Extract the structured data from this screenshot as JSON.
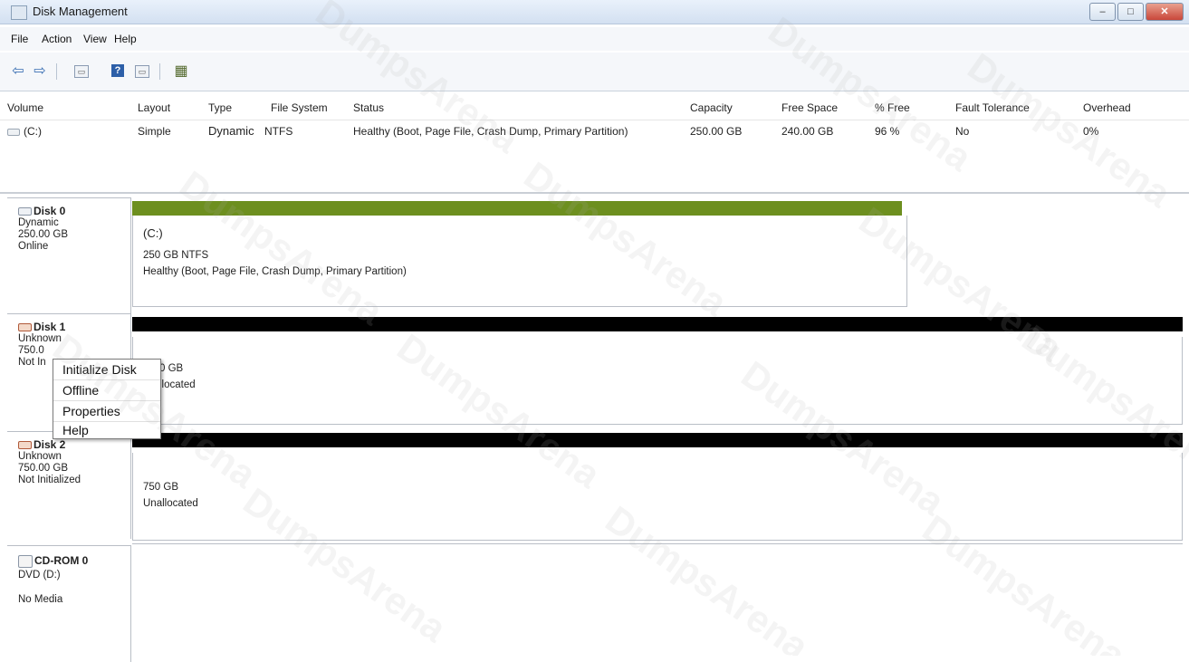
{
  "window": {
    "title": "Disk Management",
    "minimize": "–",
    "maximize": "□",
    "close": "✕"
  },
  "menu": [
    "File",
    "Action",
    "View",
    "Help"
  ],
  "toolbar_icons": [
    "back-arrow-icon",
    "forward-arrow-icon",
    "properties-icon",
    "help-icon",
    "view-icon",
    "settings-icon"
  ],
  "volume_list": {
    "columns": [
      "Volume",
      "Layout",
      "Type",
      "File System",
      "Status",
      "Capacity",
      "Free Space",
      "% Free",
      "Fault Tolerance",
      "Overhead"
    ],
    "rows": [
      {
        "volume": "(C:)",
        "layout": "Simple",
        "type": "Dynamic",
        "file_system": "NTFS",
        "status": "Healthy (Boot, Page File, Crash Dump, Primary Partition)",
        "capacity": "250.00 GB",
        "free_space": "240.00 GB",
        "pct_free": "96 %",
        "fault_tolerance": "No",
        "overhead": "0%"
      }
    ]
  },
  "disks": [
    {
      "name": "Disk 0",
      "type": "Dynamic",
      "size": "250.00 GB",
      "status": "Online",
      "partition": {
        "label": "(C:)",
        "size_fs": "250 GB NTFS",
        "status": "Healthy (Boot, Page File, Crash Dump, Primary Partition)",
        "bar_color": "#6d8f1f"
      }
    },
    {
      "name": "Disk 1",
      "type": "Unknown",
      "size": "750.0",
      "status": "Not In",
      "partition": {
        "size": "0 GB",
        "status": "llocated",
        "bar_color": "#000000"
      }
    },
    {
      "name": "Disk 2",
      "type": "Unknown",
      "size": "750.00 GB",
      "status": "Not Initialized",
      "partition": {
        "size": "750 GB",
        "status": "Unallocated",
        "bar_color": "#000000"
      }
    },
    {
      "name": "CD-ROM 0",
      "type": "DVD (D:)",
      "status": "No Media"
    }
  ],
  "context_menu": [
    "Initialize Disk",
    "Offline",
    "Properties",
    "Help"
  ],
  "watermark": "DumpsArena"
}
